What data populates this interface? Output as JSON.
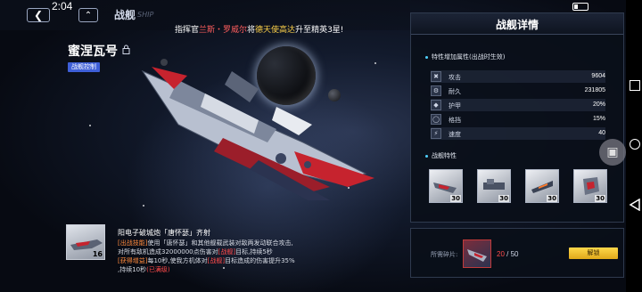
{
  "status": {
    "time": "2:04"
  },
  "header": {
    "title": "战舰",
    "title_watermark": "SHIP",
    "back_icon": "back-chevron-icon",
    "home_icon": "home-chevron-icon"
  },
  "ticker": {
    "prefix": "指挥官",
    "name": "兰斯・罗威尔",
    "middle": "将",
    "ship": "德天使高达",
    "suffix": "升至精英3星!"
  },
  "ship": {
    "name": "蜜涅瓦号",
    "tag": "战舰控制",
    "lock_icon": "lock-icon"
  },
  "skill": {
    "level": "16",
    "title": "阳电子破城炮「唐怀瑟」齐射",
    "line1_label": "[出战技能]",
    "line1_text": "使用「唐怀瑟」和其他舰载武装对敌两发动联合攻击,",
    "line2_text": "对所有敌机造成32000000点伤害对",
    "line2_tag": "[战舰]",
    "line2_end": "目标,持续5秒",
    "line3_label": "[获得增益]",
    "line3_text": "每10秒,使我方机体对",
    "line3_tag": "[战舰]",
    "line3_end": "目标造成的伤害提升35%",
    "line4_text": ",持续10秒",
    "line4_tag": "(已满级)"
  },
  "details": {
    "title": "战舰详情",
    "attr_section": "特性增加属性(出战时生效)",
    "attributes": [
      {
        "icon": "attack-icon",
        "label": "攻击",
        "value": "9604"
      },
      {
        "icon": "durability-icon",
        "label": "耐久",
        "value": "231805"
      },
      {
        "icon": "armor-icon",
        "label": "护甲",
        "value": "20%"
      },
      {
        "icon": "block-icon",
        "label": "格挡",
        "value": "15%"
      },
      {
        "icon": "speed-icon",
        "label": "速度",
        "value": "40"
      }
    ],
    "trait_section": "战舰特性",
    "traits": [
      {
        "level": "30"
      },
      {
        "level": "30"
      },
      {
        "level": "30"
      },
      {
        "level": "30"
      }
    ]
  },
  "fragments": {
    "label": "所需碎片:",
    "current": "20",
    "total": "/ 50",
    "unlock_label": "解锁"
  }
}
